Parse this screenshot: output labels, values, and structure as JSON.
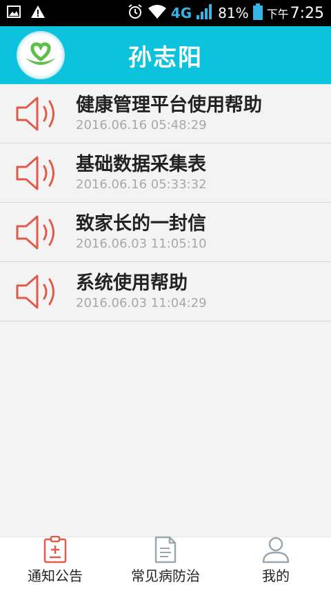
{
  "status_bar": {
    "network": "4G",
    "battery": "81%",
    "time_prefix": "下午",
    "time": "7:25"
  },
  "header": {
    "title": "孙志阳",
    "logo_icon": "heart-hands-logo-icon"
  },
  "notices": [
    {
      "title": "健康管理平台使用帮助",
      "time": "2016.06.16 05:48:29",
      "icon": "speaker-icon"
    },
    {
      "title": "基础数据采集表",
      "time": "2016.06.16 05:33:32",
      "icon": "speaker-icon"
    },
    {
      "title": "致家长的一封信",
      "time": "2016.06.03 11:05:10",
      "icon": "speaker-icon"
    },
    {
      "title": "系统使用帮助",
      "time": "2016.06.03 11:04:29",
      "icon": "speaker-icon"
    }
  ],
  "tabs": [
    {
      "label": "通知公告",
      "icon": "clipboard-icon",
      "active": true
    },
    {
      "label": "常见病防治",
      "icon": "document-icon",
      "active": false
    },
    {
      "label": "我的",
      "icon": "user-icon",
      "active": false
    }
  ],
  "colors": {
    "header": "#0cc2dc",
    "speaker": "#e05a4a",
    "active_tab_icon": "#e05a4a",
    "inactive_tab_icon": "#9aa7ad"
  }
}
